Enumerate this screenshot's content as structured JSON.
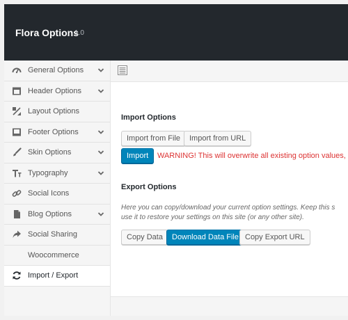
{
  "header": {
    "title": "Flora Options",
    "version": "1.0"
  },
  "sidebar": {
    "items": [
      {
        "label": "General Options",
        "icon": "dashboard-icon",
        "has_chevron": true
      },
      {
        "label": "Header Options",
        "icon": "header-icon",
        "has_chevron": true
      },
      {
        "label": "Layout Options",
        "icon": "layout-icon",
        "has_chevron": false
      },
      {
        "label": "Footer Options",
        "icon": "footer-icon",
        "has_chevron": true
      },
      {
        "label": "Skin Options",
        "icon": "brush-icon",
        "has_chevron": true
      },
      {
        "label": "Typography",
        "icon": "typography-icon",
        "has_chevron": true
      },
      {
        "label": "Social Icons",
        "icon": "link-icon",
        "has_chevron": false
      },
      {
        "label": "Blog Options",
        "icon": "document-icon",
        "has_chevron": true
      },
      {
        "label": "Social Sharing",
        "icon": "share-icon",
        "has_chevron": false
      },
      {
        "label": "Woocommerce",
        "icon": "cart-icon",
        "has_chevron": false
      },
      {
        "label": "Import / Export",
        "icon": "refresh-icon",
        "has_chevron": false,
        "active": true
      }
    ]
  },
  "import": {
    "title": "Import Options",
    "from_file_label": "Import from File",
    "from_url_label": "Import from URL",
    "import_label": "Import",
    "warning": "WARNING! This will overwrite all existing option values, plea"
  },
  "export": {
    "title": "Export Options",
    "desc_line1": "Here you can copy/download your current option settings. Keep this s",
    "desc_line2": "use it to restore your settings on this site (or any other site).",
    "copy_label": "Copy Data",
    "download_label": "Download Data File",
    "copy_url_label": "Copy Export URL"
  },
  "colors": {
    "header_bg": "#23282d",
    "primary_button": "#0085ba",
    "warning": "#dc3232"
  }
}
